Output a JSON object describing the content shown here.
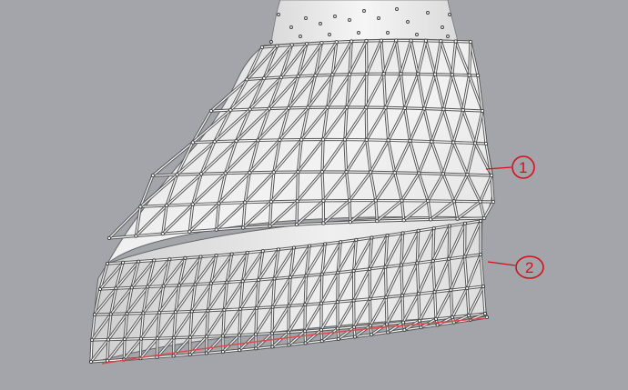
{
  "viewport": {
    "background": "#a3a5aa",
    "model_fill": "#e9e9e9",
    "strut_color": "#555555",
    "node_color": "#3a3a3a"
  },
  "annotations": {
    "color": "#d0121b",
    "items": [
      {
        "id": "annotation-1",
        "text": "1"
      },
      {
        "id": "annotation-2",
        "text": "2"
      }
    ]
  }
}
